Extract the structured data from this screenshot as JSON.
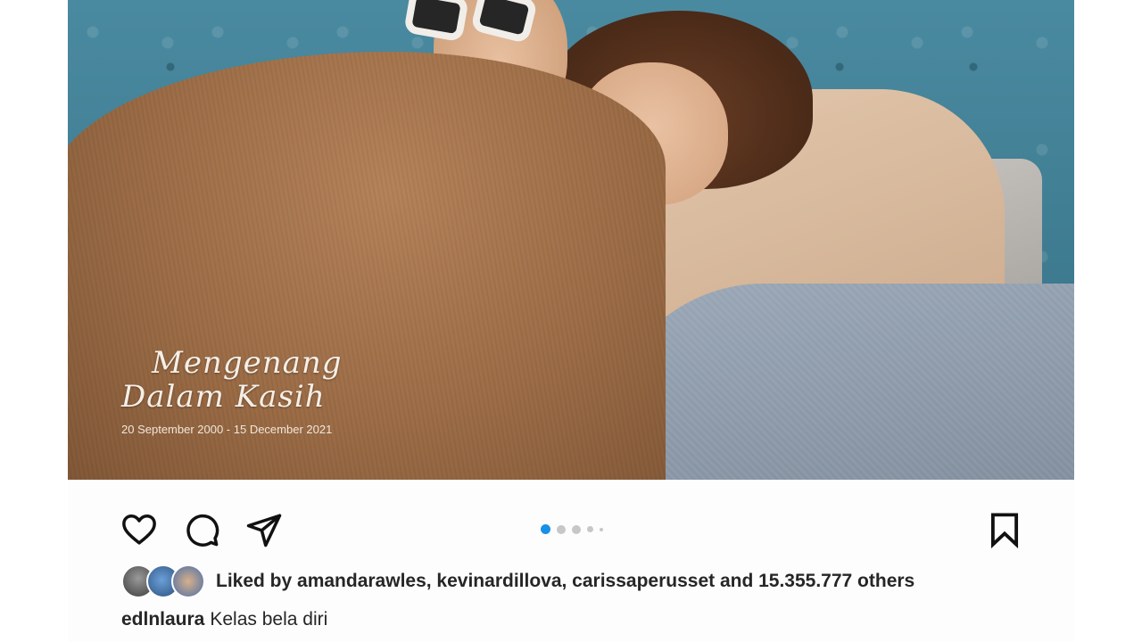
{
  "photo": {
    "overlay_title_line1": "Mengenang",
    "overlay_title_line2": "Dalam Kasih",
    "overlay_dates": "20 September 2000 - 15 December 2021"
  },
  "actions": {
    "like_icon": "heart-icon",
    "comment_icon": "comment-icon",
    "share_icon": "paper-plane-icon",
    "save_icon": "bookmark-icon"
  },
  "carousel": {
    "total_dots": 5,
    "active_index": 0,
    "active_color": "#1a8fe8",
    "inactive_color": "#c7c7c7"
  },
  "likes": {
    "text": "Liked by amandarawles, kevinardillova, carissaperusset and 15.355.777 others"
  },
  "caption": {
    "username": "edlnlaura",
    "text": "Kelas bela diri"
  }
}
